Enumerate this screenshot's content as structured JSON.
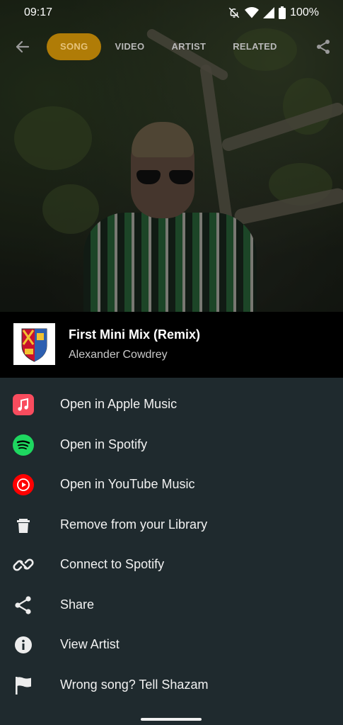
{
  "status_bar": {
    "time": "09:17",
    "battery": "100%",
    "icons": [
      "notifications-off-icon",
      "wifi-icon",
      "cellular-signal-icon",
      "battery-icon"
    ]
  },
  "top_bar": {
    "back_icon": "arrow-back-icon",
    "tabs": [
      {
        "label": "SONG",
        "active": true
      },
      {
        "label": "VIDEO",
        "active": false
      },
      {
        "label": "ARTIST",
        "active": false
      },
      {
        "label": "RELATED",
        "active": false
      }
    ],
    "share_icon": "share-icon"
  },
  "song": {
    "title": "First Mini Mix (Remix)",
    "artist": "Alexander Cowdrey",
    "album_art_icon": "album-art-crest"
  },
  "menu": {
    "items": [
      {
        "label": "Open in Apple Music",
        "icon": "apple-music-icon"
      },
      {
        "label": "Open in Spotify",
        "icon": "spotify-icon"
      },
      {
        "label": "Open in YouTube Music",
        "icon": "youtube-music-icon"
      },
      {
        "label": "Remove from your Library",
        "icon": "trash-icon"
      },
      {
        "label": "Connect to Spotify",
        "icon": "link-icon"
      },
      {
        "label": "Share",
        "icon": "share-icon"
      },
      {
        "label": "View Artist",
        "icon": "info-icon"
      },
      {
        "label": "Wrong song? Tell Shazam",
        "icon": "flag-icon"
      }
    ]
  },
  "colors": {
    "accent_tab": "#b07c07",
    "menu_bg": "#1f2a2e",
    "header_bg": "#000000",
    "apple_music": "#f94c5e",
    "spotify": "#1ed760",
    "youtube_music": "#ff0000"
  }
}
